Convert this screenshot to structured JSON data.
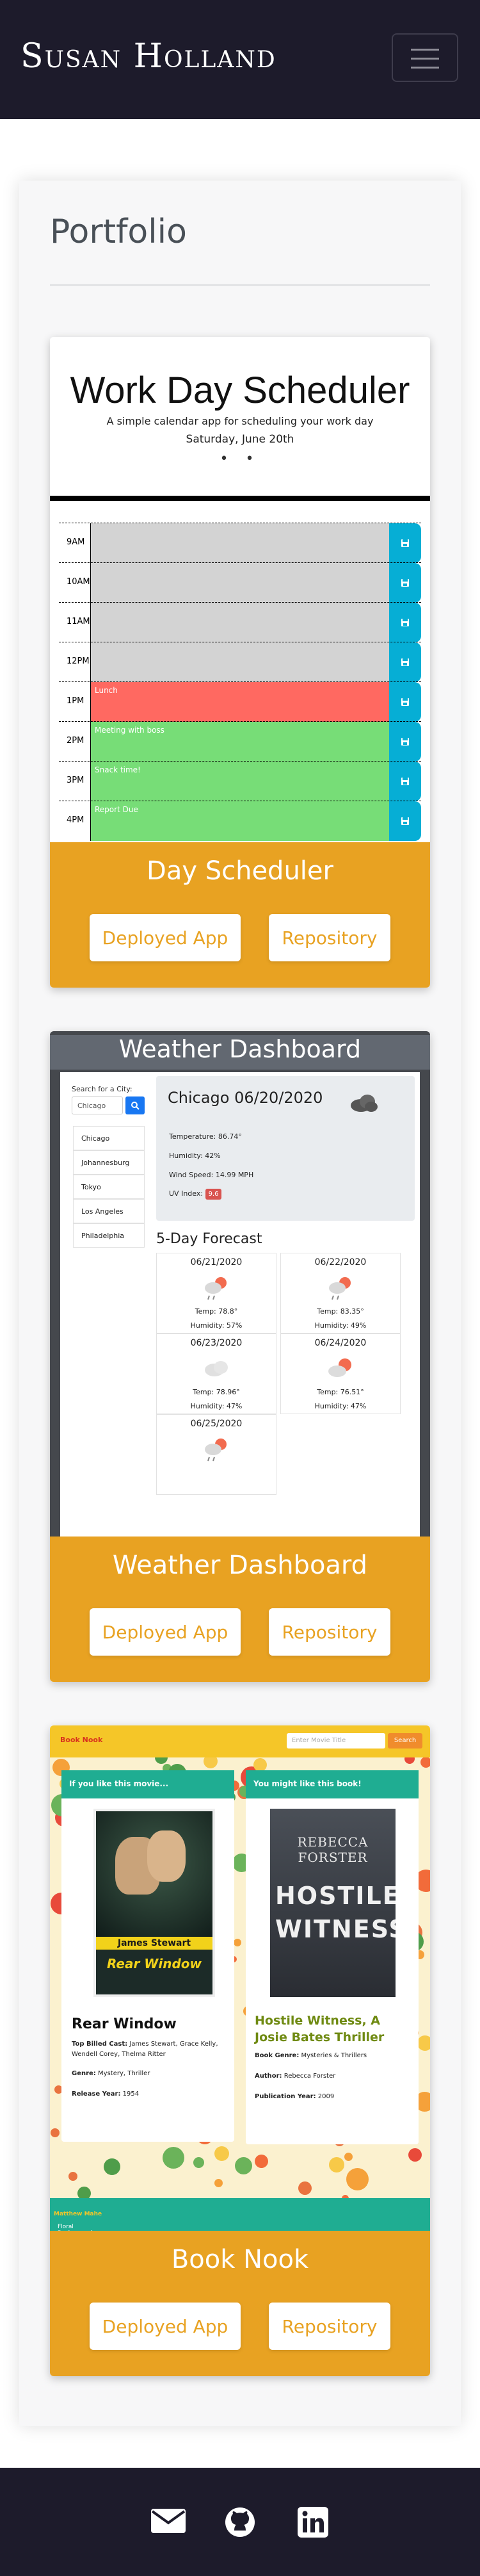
{
  "nav": {
    "brand": "Susan Holland"
  },
  "portfolio": {
    "title": "Portfolio"
  },
  "projects": [
    {
      "title": "Day Scheduler",
      "deployed_label": "Deployed App",
      "repo_label": "Repository",
      "screenshot": {
        "app_title": "Work Day Scheduler",
        "subtitle": "A simple calendar app for scheduling your work day",
        "date": "Saturday, June 20th",
        "dots": "• •",
        "hours": [
          {
            "hour": "9AM",
            "text": "",
            "state": "past"
          },
          {
            "hour": "10AM",
            "text": "",
            "state": "past"
          },
          {
            "hour": "11AM",
            "text": "",
            "state": "past"
          },
          {
            "hour": "12PM",
            "text": "",
            "state": "past"
          },
          {
            "hour": "1PM",
            "text": "Lunch",
            "state": "present"
          },
          {
            "hour": "2PM",
            "text": "Meeting with boss",
            "state": "future"
          },
          {
            "hour": "3PM",
            "text": "Snack time!",
            "state": "future"
          },
          {
            "hour": "4PM",
            "text": "Report Due",
            "state": "future"
          }
        ]
      }
    },
    {
      "title": "Weather Dashboard",
      "deployed_label": "Deployed App",
      "repo_label": "Repository",
      "screenshot": {
        "app_title": "Weather Dashboard",
        "search_label": "Search for a City:",
        "search_value": "Chicago",
        "cities": [
          "Chicago",
          "Johannesburg",
          "Tokyo",
          "Los Angeles",
          "Philadelphia"
        ],
        "current": {
          "heading": "Chicago  06/20/2020",
          "temp": "Temperature: 86.74°",
          "humidity": "Humidity: 42%",
          "wind": "Wind Speed: 14.99 MPH",
          "uv_label": "UV Index:",
          "uv_value": "9.6"
        },
        "forecast_title": "5-Day Forecast",
        "forecast": [
          {
            "date": "06/21/2020",
            "temp": "Temp: 78.8°",
            "humidity": "Humidity: 57%",
            "icon": "sun-rain-icon"
          },
          {
            "date": "06/22/2020",
            "temp": "Temp: 83.35°",
            "humidity": "Humidity: 49%",
            "icon": "sun-rain-icon"
          },
          {
            "date": "06/23/2020",
            "temp": "Temp: 78.96°",
            "humidity": "Humidity: 47%",
            "icon": "cloud-icon"
          },
          {
            "date": "06/24/2020",
            "temp": "Temp: 76.51°",
            "humidity": "Humidity: 47%",
            "icon": "sun-cloud-icon"
          },
          {
            "date": "06/25/2020",
            "temp": "",
            "humidity": "",
            "icon": "sun-rain-icon"
          }
        ]
      }
    },
    {
      "title": "Book Nook",
      "deployed_label": "Deployed App",
      "repo_label": "Repository",
      "screenshot": {
        "brand": "Book Nook",
        "search_placeholder": "Enter Movie Title",
        "search_button": "Search",
        "left": {
          "header": "If you like this movie...",
          "poster_top": "James Stewart",
          "poster_title": "Rear Window",
          "title": "Rear Window",
          "cast_label": "Top Billed Cast:",
          "cast": "James Stewart, Grace Kelly, Wendell Corey, Thelma Ritter",
          "genre_label": "Genre:",
          "genre": "Mystery, Thriller",
          "year_label": "Release Year:",
          "year": "1954"
        },
        "right": {
          "header": "You might like this book!",
          "cover_author": "REBECCA FORSTER",
          "cover_title": "HOSTILE WITNESS",
          "title": "Hostile Witness, A Josie Bates Thriller",
          "genre_label": "Book Genre:",
          "genre": "Mysteries & Thrillers",
          "author_label": "Author:",
          "author": "Rebecca Forster",
          "pub_label": "Publication Year:",
          "pub": "2009"
        },
        "footer_text": "Floral Background Art by:",
        "footer_artist": "Matthew Mahe"
      }
    }
  ],
  "colors": {
    "navy": "#1d1b2b",
    "accent": "#e8a222",
    "teal": "#1fad92"
  }
}
